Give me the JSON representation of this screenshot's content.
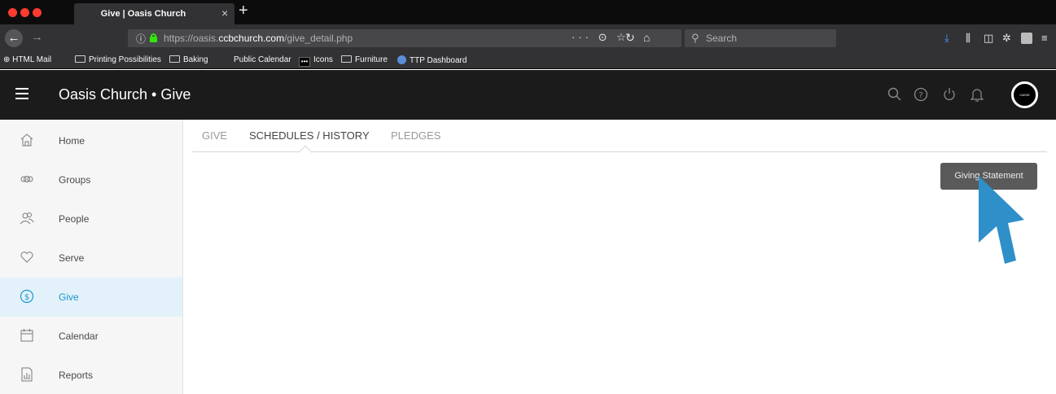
{
  "browser": {
    "tab_title": "Give | Oasis Church",
    "tab_close": "×",
    "new_tab": "+",
    "url_prefix": "https://oasis.",
    "url_host": "ccbchurch.com",
    "url_path": "/give_detail.php",
    "url_actions": "··· ⊙ ☆",
    "search_placeholder": "Search",
    "bookmarks": [
      {
        "label": "HTML Mail",
        "icon": "globe-icon"
      },
      {
        "label": "Printing Possibilities",
        "icon": "folder-icon"
      },
      {
        "label": "Baking",
        "icon": "folder-icon"
      },
      {
        "label": "Public Calendar",
        "icon": "blank"
      },
      {
        "label": "Icons",
        "icon": "dots-icon"
      },
      {
        "label": "Furniture",
        "icon": "folder-icon"
      },
      {
        "label": "TTP Dashboard",
        "icon": "blue-circle-icon"
      }
    ],
    "colors": {
      "tabbar": "#0c0c0d",
      "toolbar": "#323234",
      "lock": "#30e60b",
      "download": "#45a1ff"
    }
  },
  "header": {
    "title": "Oasis Church • Give",
    "avatar_text": "OASIS",
    "icons": [
      "search-icon",
      "help-icon",
      "power-icon",
      "bell-icon"
    ]
  },
  "sidebar": {
    "items": [
      {
        "label": "Home",
        "icon": "home-icon",
        "active": false
      },
      {
        "label": "Groups",
        "icon": "groups-icon",
        "active": false
      },
      {
        "label": "People",
        "icon": "people-icon",
        "active": false
      },
      {
        "label": "Serve",
        "icon": "heart-icon",
        "active": false
      },
      {
        "label": "Give",
        "icon": "dollar-circle-icon",
        "active": true
      },
      {
        "label": "Calendar",
        "icon": "calendar-icon",
        "active": false
      },
      {
        "label": "Reports",
        "icon": "report-icon",
        "active": false
      }
    ],
    "accent": "#1b95d0"
  },
  "main": {
    "tabs": [
      {
        "label": "GIVE",
        "active": false
      },
      {
        "label": "SCHEDULES / HISTORY",
        "active": true
      },
      {
        "label": "PLEDGES",
        "active": false
      }
    ],
    "giving_statement_button": "Giving Statement",
    "pointer_color": "#2e8fc9"
  }
}
